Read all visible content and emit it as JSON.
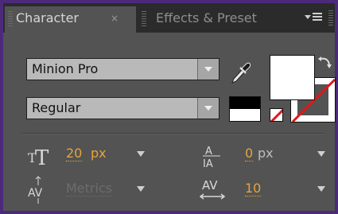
{
  "panel": {
    "tabs": [
      {
        "label": "Character",
        "active": true
      },
      {
        "label": "Effects & Preset",
        "active": false
      }
    ],
    "close_glyph": "×"
  },
  "font": {
    "family": "Minion Pro",
    "style": "Regular"
  },
  "colors": {
    "fill": "#ffffff",
    "stroke": "#ffffff",
    "accent_number": "#e6a43a",
    "panel_bg": "#535353",
    "frame": "#4b2a7b"
  },
  "params": {
    "font_size": {
      "value": "20",
      "unit": "px"
    },
    "leading": {
      "value": "0",
      "unit": "px"
    },
    "kerning": {
      "value": "Metrics"
    },
    "tracking": {
      "value": "10"
    }
  },
  "icons": {
    "eyedropper": "eyedropper-icon",
    "swap": "swap-colors-icon",
    "font_size": "font-size-icon",
    "leading": "leading-icon",
    "kerning": "kerning-icon",
    "tracking": "tracking-icon"
  }
}
